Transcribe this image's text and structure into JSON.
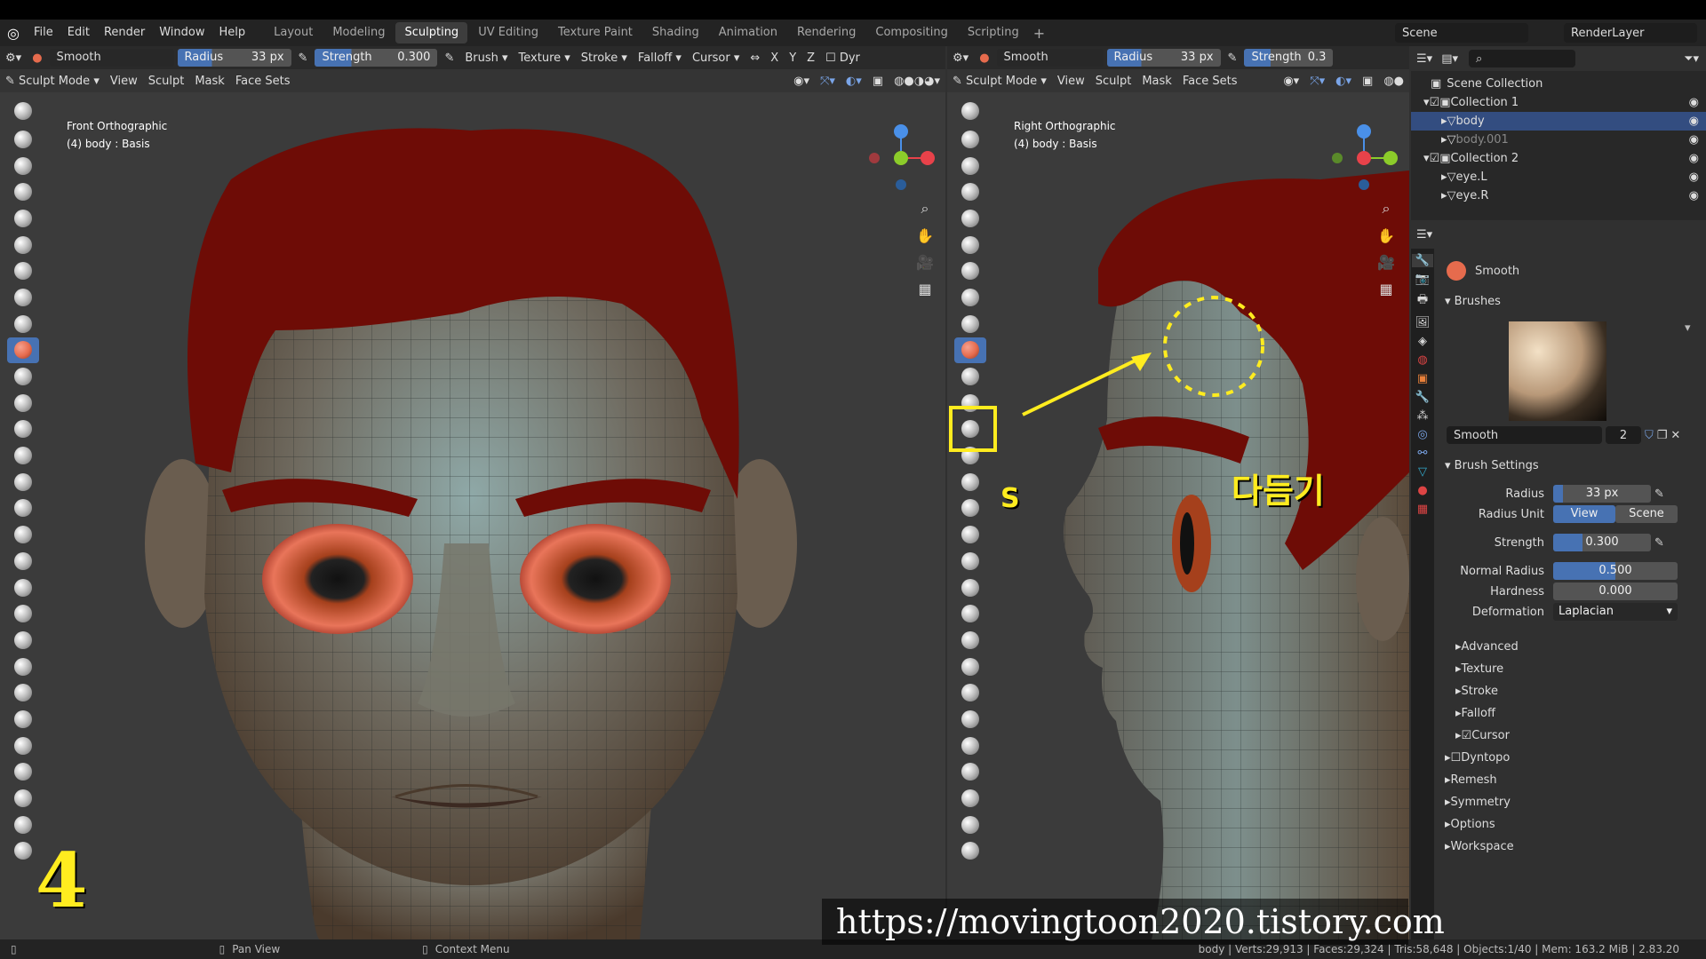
{
  "menu": [
    "File",
    "Edit",
    "Render",
    "Window",
    "Help"
  ],
  "workspaces": [
    "Layout",
    "Modeling",
    "Sculpting",
    "UV Editing",
    "Texture Paint",
    "Shading",
    "Animation",
    "Rendering",
    "Compositing",
    "Scripting"
  ],
  "active_workspace": "Sculpting",
  "scene": "Scene",
  "render_layer": "RenderLayer",
  "tool_header": {
    "brush": "Smooth",
    "radius_label": "Radius",
    "radius_value": "33 px",
    "strength_label": "Strength",
    "strength_value": "0.300",
    "strength_value_right": "0.3",
    "menus": [
      "Brush",
      "Texture",
      "Stroke",
      "Falloff",
      "Cursor"
    ],
    "axes": [
      "X",
      "Y",
      "Z"
    ],
    "dyntopo_short": "Dyr"
  },
  "viewport_header": {
    "mode": "Sculpt Mode",
    "menus": [
      "View",
      "Sculpt",
      "Mask",
      "Face Sets"
    ]
  },
  "left_viewport": {
    "view_name": "Front Orthographic",
    "object_info": "(4) body : Basis",
    "overlay_number": "4"
  },
  "right_viewport": {
    "view_name": "Right Orthographic",
    "object_info": "(4) body : Basis",
    "annotation_key": "S",
    "annotation_text": "다듬기"
  },
  "outliner": {
    "root": "Scene Collection",
    "items": [
      {
        "name": "Collection 1",
        "level": 1,
        "selected": false
      },
      {
        "name": "body",
        "level": 2,
        "selected": true
      },
      {
        "name": "body.001",
        "level": 2,
        "selected": false
      },
      {
        "name": "Collection 2",
        "level": 1,
        "selected": false
      },
      {
        "name": "eye.L",
        "level": 2,
        "selected": false
      },
      {
        "name": "eye.R",
        "level": 2,
        "selected": false
      }
    ]
  },
  "properties": {
    "tool_name": "Smooth",
    "brushes_title": "Brushes",
    "brush_field": "Smooth",
    "brush_users": "2",
    "brush_settings_title": "Brush Settings",
    "radius_label": "Radius",
    "radius_value": "33 px",
    "radius_unit_label": "Radius Unit",
    "radius_unit_options": [
      "View",
      "Scene"
    ],
    "strength_label": "Strength",
    "strength_value": "0.300",
    "normal_radius_label": "Normal Radius",
    "normal_radius_value": "0.500",
    "hardness_label": "Hardness",
    "hardness_value": "0.000",
    "deformation_label": "Deformation",
    "deformation_value": "Laplacian",
    "subpanels": [
      "Advanced",
      "Texture",
      "Stroke",
      "Falloff",
      "Cursor"
    ],
    "panels": [
      "Dyntopo",
      "Remesh",
      "Symmetry",
      "Options",
      "Workspace"
    ]
  },
  "status": {
    "pan": "Pan View",
    "context": "Context Menu",
    "stats": "body | Verts:29,913 | Faces:29,324 | Tris:58,648 | Objects:1/40 | Mem: 163.2 MiB | 2.83.20"
  },
  "watermark": "https://movingtoon2020.tistory.com",
  "colors": {
    "accent": "#4772b3",
    "annotation": "#ffec1f",
    "hair": "#6e0c06"
  }
}
